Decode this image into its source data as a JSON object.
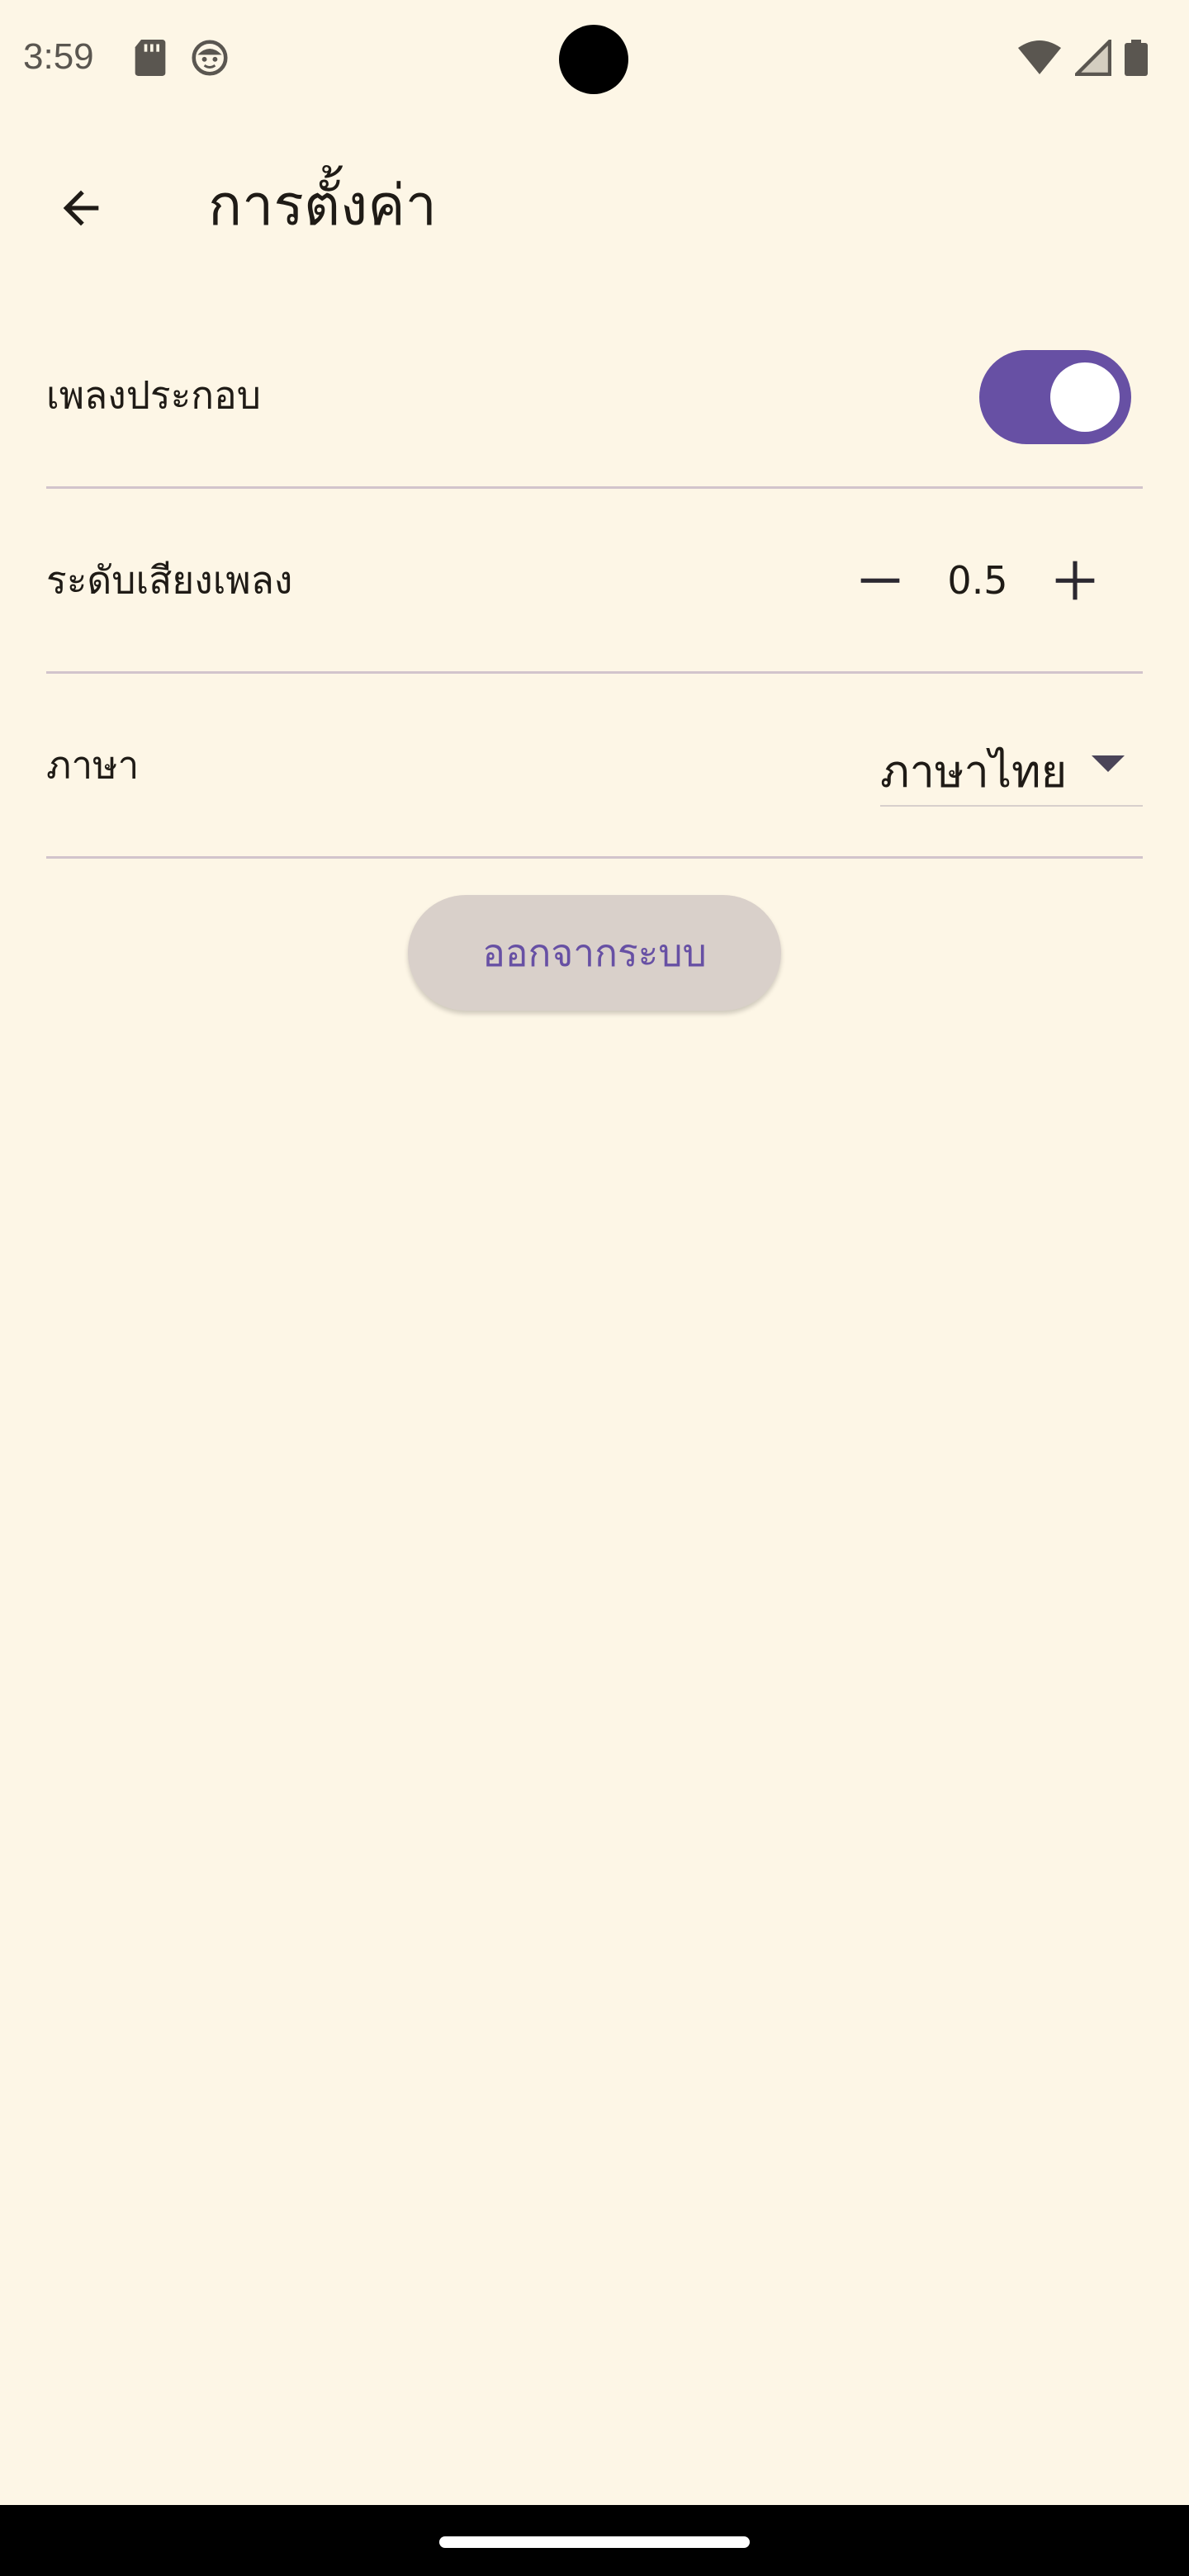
{
  "status_bar": {
    "time": "3:59",
    "left_icons": [
      "sd-card-icon",
      "face-icon"
    ],
    "right_icons": [
      "wifi-icon",
      "signal-icon",
      "battery-icon"
    ]
  },
  "app_bar": {
    "back_icon": "arrow-back-icon",
    "title": "การตั้งค่า"
  },
  "settings": {
    "background_music": {
      "label": "เพลงประกอบ",
      "enabled": true
    },
    "music_volume": {
      "label": "ระดับเสียงเพลง",
      "value": "0.5",
      "decrement_icon": "minus-icon",
      "increment_icon": "plus-icon"
    },
    "language": {
      "label": "ภาษา",
      "selected": "ภาษาไทย",
      "arrow_icon": "dropdown-arrow-icon"
    }
  },
  "logout": {
    "label": "ออกจากระบบ"
  },
  "colors": {
    "background": "#fdf6e6",
    "accent": "#6750a4",
    "divider": "#d2c4cc",
    "button_bg": "#d9d0ca"
  }
}
